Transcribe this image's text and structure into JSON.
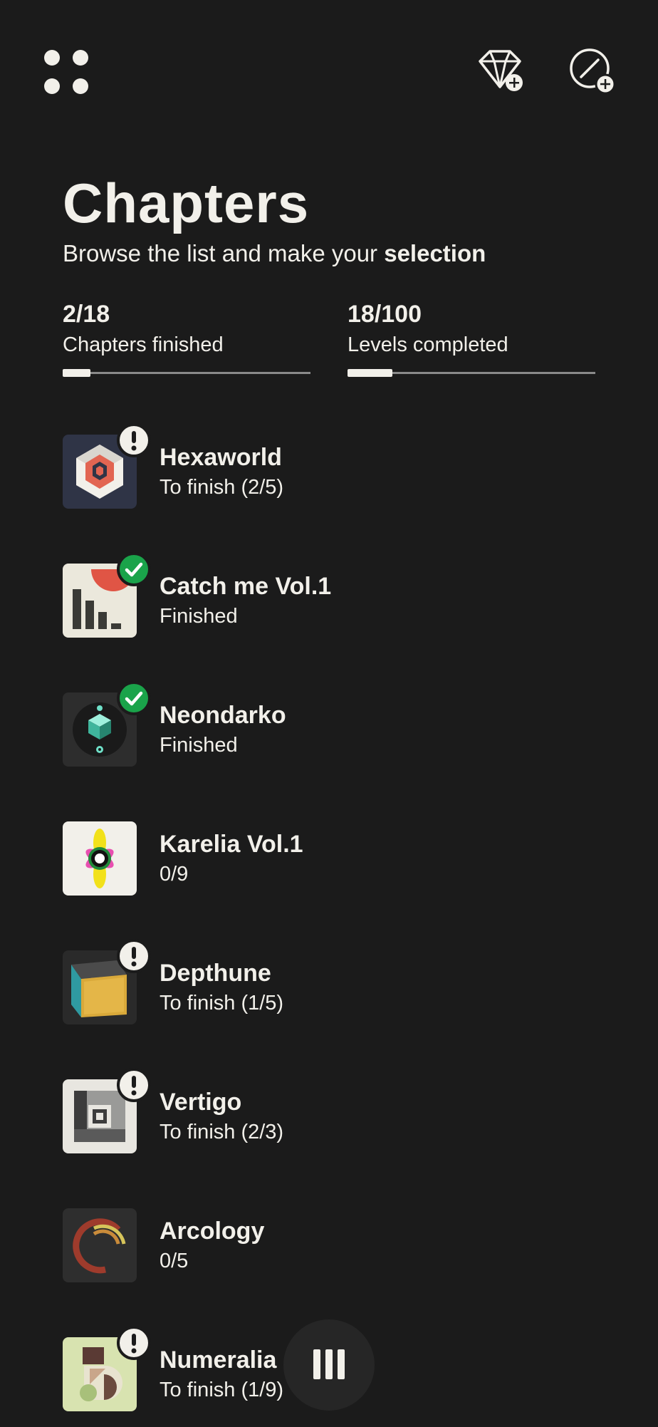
{
  "header": {
    "title": "Chapters",
    "subtitle_prefix": "Browse the list and make your ",
    "subtitle_emphasis": "selection"
  },
  "stats": [
    {
      "value": "2/18",
      "label": "Chapters finished",
      "progress": 0.111
    },
    {
      "value": "18/100",
      "label": "Levels completed",
      "progress": 0.18
    }
  ],
  "chapters": [
    {
      "name": "Hexaworld",
      "status": "To finish (2/5)",
      "badge": "attention",
      "icon": "hexagon-cube-icon"
    },
    {
      "name": "Catch me Vol.1",
      "status": "Finished",
      "badge": "completed",
      "icon": "bar-chart-sun-icon"
    },
    {
      "name": "Neondarko",
      "status": "Finished",
      "badge": "completed",
      "icon": "neon-cube-icon"
    },
    {
      "name": "Karelia Vol.1",
      "status": "0/9",
      "badge": "none",
      "icon": "flower-icon"
    },
    {
      "name": "Depthune",
      "status": "To finish (1/5)",
      "badge": "attention",
      "icon": "colored-cube-icon"
    },
    {
      "name": "Vertigo",
      "status": "To finish (2/3)",
      "badge": "attention",
      "icon": "concentric-squares-icon"
    },
    {
      "name": "Arcology",
      "status": "0/5",
      "badge": "none",
      "icon": "arcs-icon"
    },
    {
      "name": "Numeralia",
      "status": "To finish (1/9)",
      "badge": "attention",
      "icon": "numeral-shapes-icon"
    }
  ],
  "colors": {
    "background": "#1b1b1b",
    "text": "#f2f0ea",
    "completed_badge": "#1aa34a",
    "progress_track": "#8a8a8a"
  }
}
